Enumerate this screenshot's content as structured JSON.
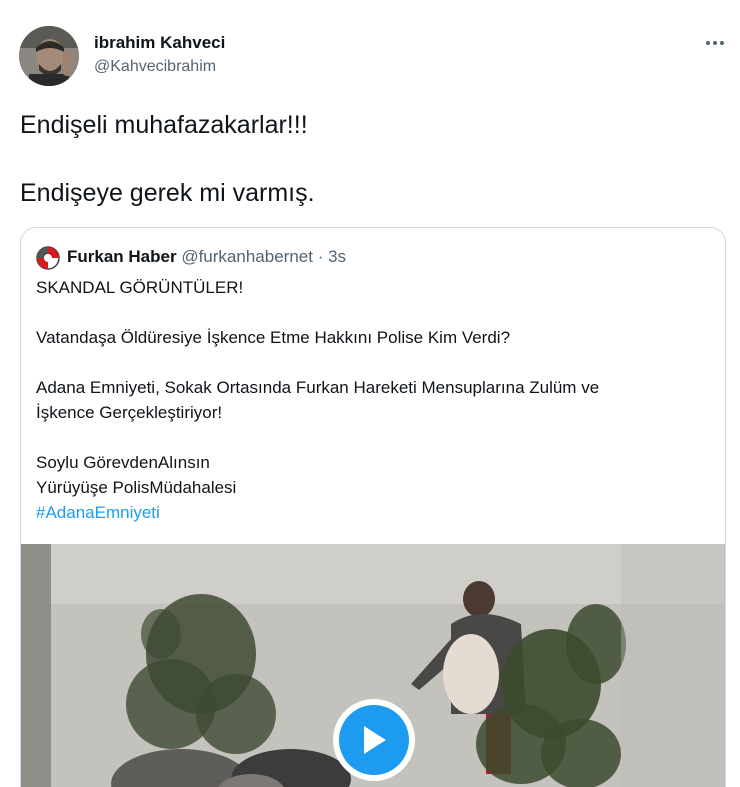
{
  "author": {
    "name": "ibrahim Kahveci",
    "handle": "@Kahvecibrahim"
  },
  "tweet": {
    "line1": "Endişeli muhafazakarlar!!!",
    "line2": "Endişeye gerek mi varmış."
  },
  "quoted": {
    "name": "Furkan Haber",
    "handle": "@furkanhabernet",
    "separator": "·",
    "time": "3s",
    "lines": [
      "SKANDAL GÖRÜNTÜLER!",
      "Vatandaşa Öldüresiye İşkence Etme Hakkını Polise Kim Verdi?",
      "Adana Emniyeti, Sokak Ortasında Furkan Hareketi Mensuplarına Zulüm ve",
      "İşkence Gerçekleştiriyor!",
      "Soylu GörevdenAlınsın",
      "Yürüyüşe PolisMüdahalesi",
      "#AdanaEmniyeti"
    ]
  },
  "icons": {
    "more": "more-horizontal-icon",
    "play": "play-icon"
  },
  "colors": {
    "accent": "#1d9bf0",
    "text": "#0f1419",
    "secondary": "#536471",
    "border": "#cfd9de"
  }
}
